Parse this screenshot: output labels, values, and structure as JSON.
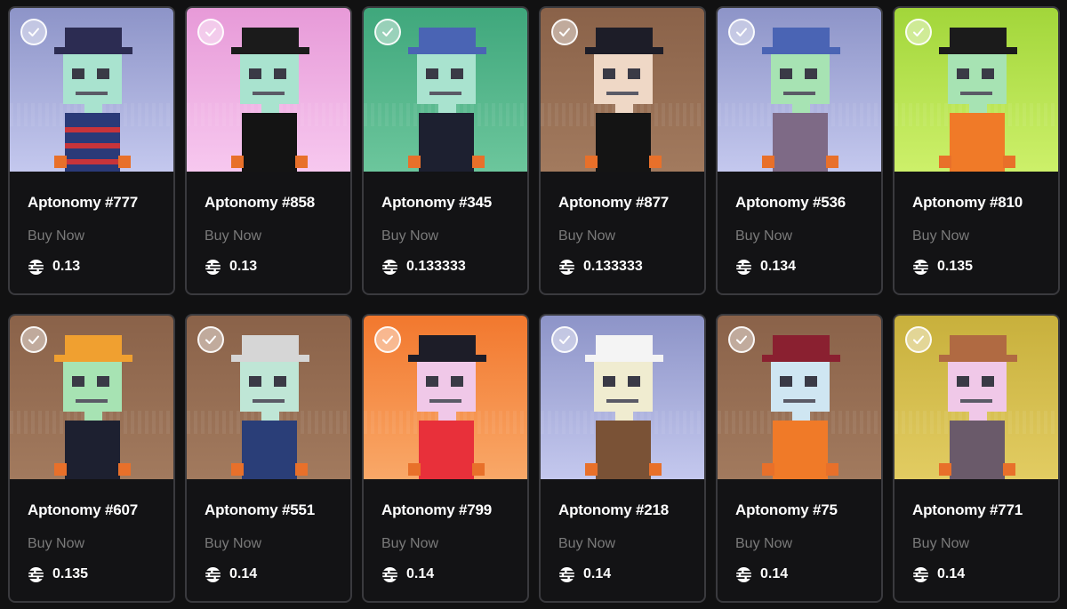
{
  "listings": [
    {
      "name": "Aptonomy #777",
      "action": "Buy Now",
      "price": "0.13",
      "colors": {
        "bg_top": "#8d94c8",
        "bg_bottom": "#c4c8ee",
        "skin": "#a9e3cf",
        "shirt": "#2a3a78",
        "stripe": "#c8343a",
        "hat": "#2c2c52"
      }
    },
    {
      "name": "Aptonomy #858",
      "action": "Buy Now",
      "price": "0.13",
      "colors": {
        "bg_top": "#e79ad8",
        "bg_bottom": "#f7c8ef",
        "skin": "#a9e3cf",
        "shirt": "#141414",
        "stripe": "#141414",
        "hat": "#1b1b1b"
      }
    },
    {
      "name": "Aptonomy #345",
      "action": "Buy Now",
      "price": "0.133333",
      "colors": {
        "bg_top": "#3fa77c",
        "bg_bottom": "#6cc69c",
        "skin": "#a9e3cf",
        "shirt": "#1d2030",
        "stripe": "#1d2030",
        "hat": "#4a64b4"
      }
    },
    {
      "name": "Aptonomy #877",
      "action": "Buy Now",
      "price": "0.133333",
      "colors": {
        "bg_top": "#8a6249",
        "bg_bottom": "#a27a5e",
        "skin": "#efd8c6",
        "shirt": "#141414",
        "stripe": "#141414",
        "hat": "#1d1d28"
      }
    },
    {
      "name": "Aptonomy #536",
      "action": "Buy Now",
      "price": "0.134",
      "colors": {
        "bg_top": "#8d94c8",
        "bg_bottom": "#c4c8ee",
        "skin": "#a7e3b3",
        "shirt": "#7e6a86",
        "stripe": "#7e6a86",
        "hat": "#4a64b4"
      }
    },
    {
      "name": "Aptonomy #810",
      "action": "Buy Now",
      "price": "0.135",
      "colors": {
        "bg_top": "#a2d63a",
        "bg_bottom": "#cdf06a",
        "skin": "#a7e3b3",
        "shirt": "#f07a28",
        "stripe": "#f07a28",
        "hat": "#1b1b1b"
      }
    },
    {
      "name": "Aptonomy #607",
      "action": "Buy Now",
      "price": "0.135",
      "colors": {
        "bg_top": "#8a6249",
        "bg_bottom": "#a27a5e",
        "skin": "#a7e3b3",
        "shirt": "#1d2030",
        "stripe": "#1d2030",
        "hat": "#f0a030"
      }
    },
    {
      "name": "Aptonomy #551",
      "action": "Buy Now",
      "price": "0.14",
      "colors": {
        "bg_top": "#8a6249",
        "bg_bottom": "#a27a5e",
        "skin": "#bfe6d6",
        "shirt": "#2a3e78",
        "stripe": "#2a3e78",
        "hat": "#d6d6d6"
      }
    },
    {
      "name": "Aptonomy #799",
      "action": "Buy Now",
      "price": "0.14",
      "colors": {
        "bg_top": "#f2782e",
        "bg_bottom": "#f9a868",
        "skin": "#f0c8e8",
        "shirt": "#e8303a",
        "stripe": "#e8303a",
        "hat": "#1d1d28"
      }
    },
    {
      "name": "Aptonomy #218",
      "action": "Buy Now",
      "price": "0.14",
      "colors": {
        "bg_top": "#8d94c8",
        "bg_bottom": "#c4c8ee",
        "skin": "#f0ecd0",
        "shirt": "#7a5236",
        "stripe": "#7a5236",
        "hat": "#f4f4f4"
      }
    },
    {
      "name": "Aptonomy #75",
      "action": "Buy Now",
      "price": "0.14",
      "colors": {
        "bg_top": "#8a6249",
        "bg_bottom": "#a27a5e",
        "skin": "#cfe6f2",
        "shirt": "#f07a28",
        "stripe": "#f07a28",
        "hat": "#8a2030"
      }
    },
    {
      "name": "Aptonomy #771",
      "action": "Buy Now",
      "price": "0.14",
      "colors": {
        "bg_top": "#c8b03c",
        "bg_bottom": "#e2cc62",
        "skin": "#f0c8e8",
        "shirt": "#6a5a6a",
        "stripe": "#6a5a6a",
        "hat": "#b06a42"
      }
    }
  ]
}
